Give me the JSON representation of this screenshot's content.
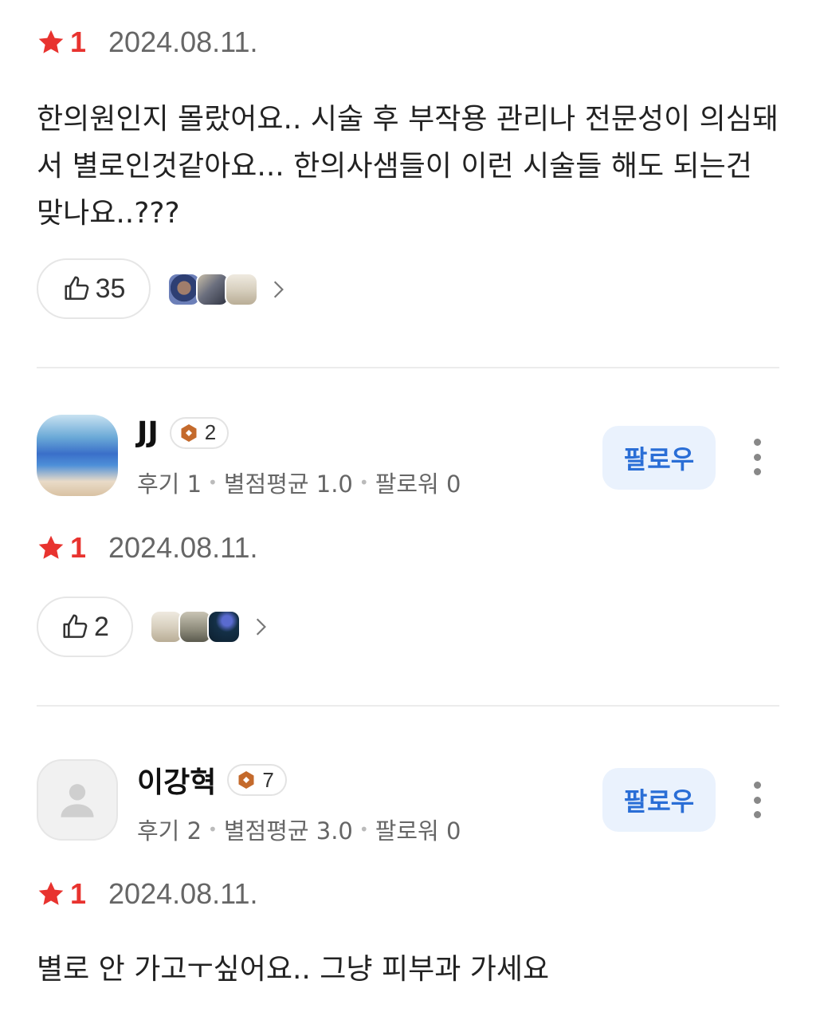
{
  "reviews": [
    {
      "rating": "1",
      "date": "2024.08.11.",
      "text": "한의원인지 몰랐어요.. 시술 후 부작용 관리나 전문성이 의심돼서 별로인것같아요... 한의사샘들이 이런 시술들 해도 되는건 맞나요..???",
      "likes": "35"
    },
    {
      "user": {
        "name": "JJ",
        "level": "2",
        "reviews_label": "후기 1",
        "avg_label": "별점평균 1.0",
        "followers_label": "팔로워 0",
        "follow_label": "팔로우"
      },
      "rating": "1",
      "date": "2024.08.11.",
      "likes": "2"
    },
    {
      "user": {
        "name": "이강혁",
        "level": "7",
        "reviews_label": "후기 2",
        "avg_label": "별점평균 3.0",
        "followers_label": "팔로워 0",
        "follow_label": "팔로우"
      },
      "rating": "1",
      "date": "2024.08.11.",
      "text": "별로 안 가고ㅜ싶어요.. 그냥 피부과 가세요"
    }
  ],
  "icons": {
    "star": "star-icon",
    "like": "thumbs-up-icon",
    "chevron": "chevron-right-icon",
    "level": "level-badge-icon",
    "more": "more-vertical-icon",
    "avatar_default": "person-icon"
  },
  "colors": {
    "star": "#e8332f",
    "follow_bg": "#eaf2fd",
    "follow_text": "#2a6ed6",
    "level_badge": "#c46a2c"
  }
}
